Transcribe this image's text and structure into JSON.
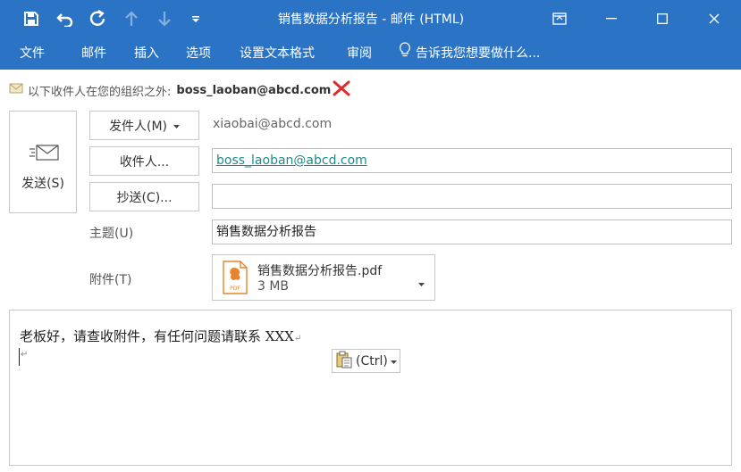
{
  "window": {
    "title": "销售数据分析报告 - 邮件 (HTML)"
  },
  "ribbon": {
    "tabs": [
      "文件",
      "邮件",
      "插入",
      "选项",
      "设置文本格式",
      "审阅"
    ],
    "tell_me": "告诉我您想要做什么..."
  },
  "infobar": {
    "text": "以下收件人在您的组织之外:",
    "email": "boss_laoban@abcd.com"
  },
  "send": {
    "label": "发送(S)"
  },
  "from": {
    "label": "发件人(M)",
    "value": "xiaobai@abcd.com"
  },
  "to": {
    "label": "收件人...",
    "value": "boss_laoban@abcd.com"
  },
  "cc": {
    "label": "抄送(C)...",
    "value": ""
  },
  "subject": {
    "label": "主题(U)",
    "value": "销售数据分析报告"
  },
  "attachment": {
    "label": "附件(T)",
    "filename": "销售数据分析报告.pdf",
    "size": "3 MB",
    "icon_text": "PDF"
  },
  "body": {
    "line1": "老板好，请查收附件，有任何问题请联系 XXX",
    "paste_options": "(Ctrl)"
  },
  "colors": {
    "titlebar": "#2b74c5",
    "link": "#1e8a8a",
    "error_x": "#e02b2b",
    "pdf_orange": "#e8842c"
  }
}
